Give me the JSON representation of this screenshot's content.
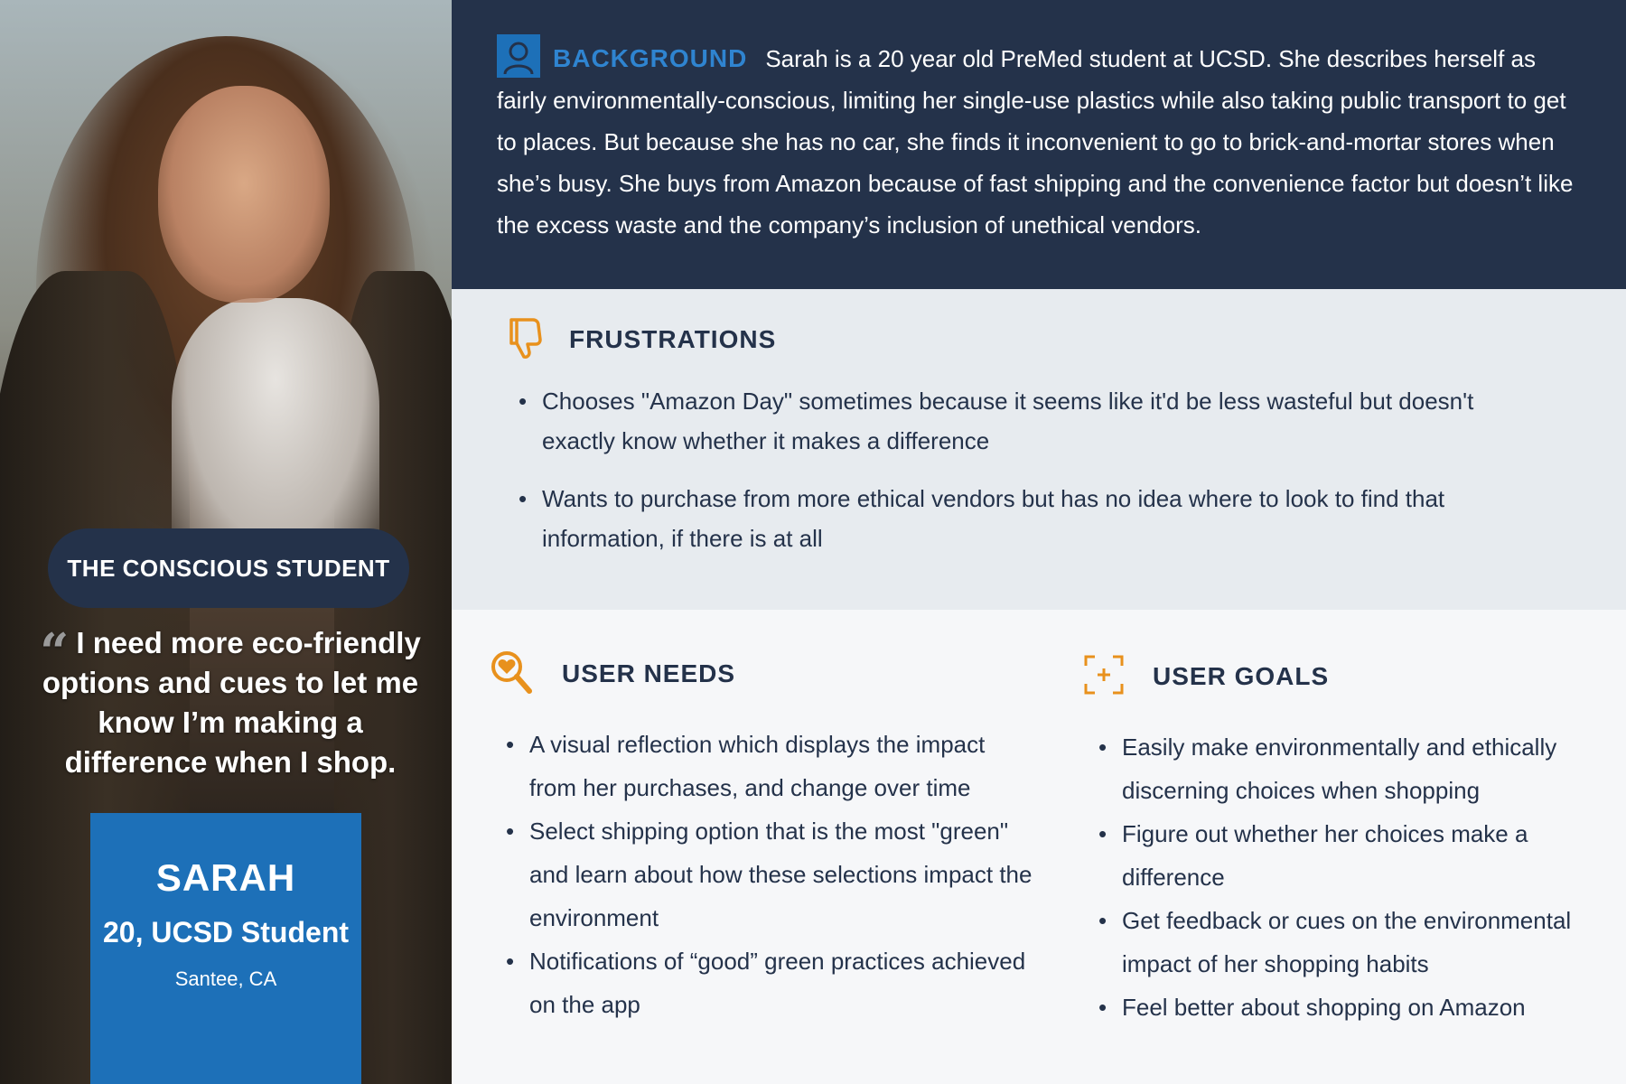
{
  "persona": {
    "tag": "THE CONSCIOUS STUDENT",
    "quote": "I need more eco-friendly options and cues to let me know I’m making a difference when I shop.",
    "name": "SARAH",
    "role": "20, UCSD Student",
    "location": "Santee, CA"
  },
  "background": {
    "title": "BACKGROUND",
    "icon": "user-icon",
    "text": "Sarah is a 20 year old PreMed student at UCSD. She describes herself as fairly environmentally-conscious, limiting her single-use plastics while also taking public transport to get to places. But because she has no car, she finds it inconvenient to go to brick-and-mortar stores when she’s busy. She buys from Amazon because of fast shipping and the convenience factor but doesn’t like the excess waste and the company’s inclusion of unethical vendors."
  },
  "frustrations": {
    "title": "FRUSTRATIONS",
    "icon": "thumbs-down-icon",
    "items": [
      "Chooses \"Amazon Day\" sometimes because it seems like it'd be less wasteful but doesn't exactly know whether it makes a difference",
      "Wants to purchase from more ethical vendors but has no idea where to look to find that information, if there is at all"
    ]
  },
  "needs": {
    "title": "USER NEEDS",
    "icon": "search-heart-icon",
    "items": [
      "A visual reflection which displays the impact from her purchases, and change over time",
      "Select shipping option that is the most \"green\" and learn about how these selections impact the environment",
      "Notifications of “good” green practices achieved on the app"
    ]
  },
  "goals": {
    "title": "USER GOALS",
    "icon": "focus-plus-icon",
    "items": [
      "Easily make environmentally and ethically discerning choices when shopping",
      "Figure out whether her choices make a difference",
      "Get feedback or cues on the environmental impact of her shopping habits",
      "Feel better about shopping on Amazon"
    ]
  },
  "colors": {
    "navy": "#24324a",
    "blue": "#1d70b8",
    "accent": "#e8911d"
  }
}
